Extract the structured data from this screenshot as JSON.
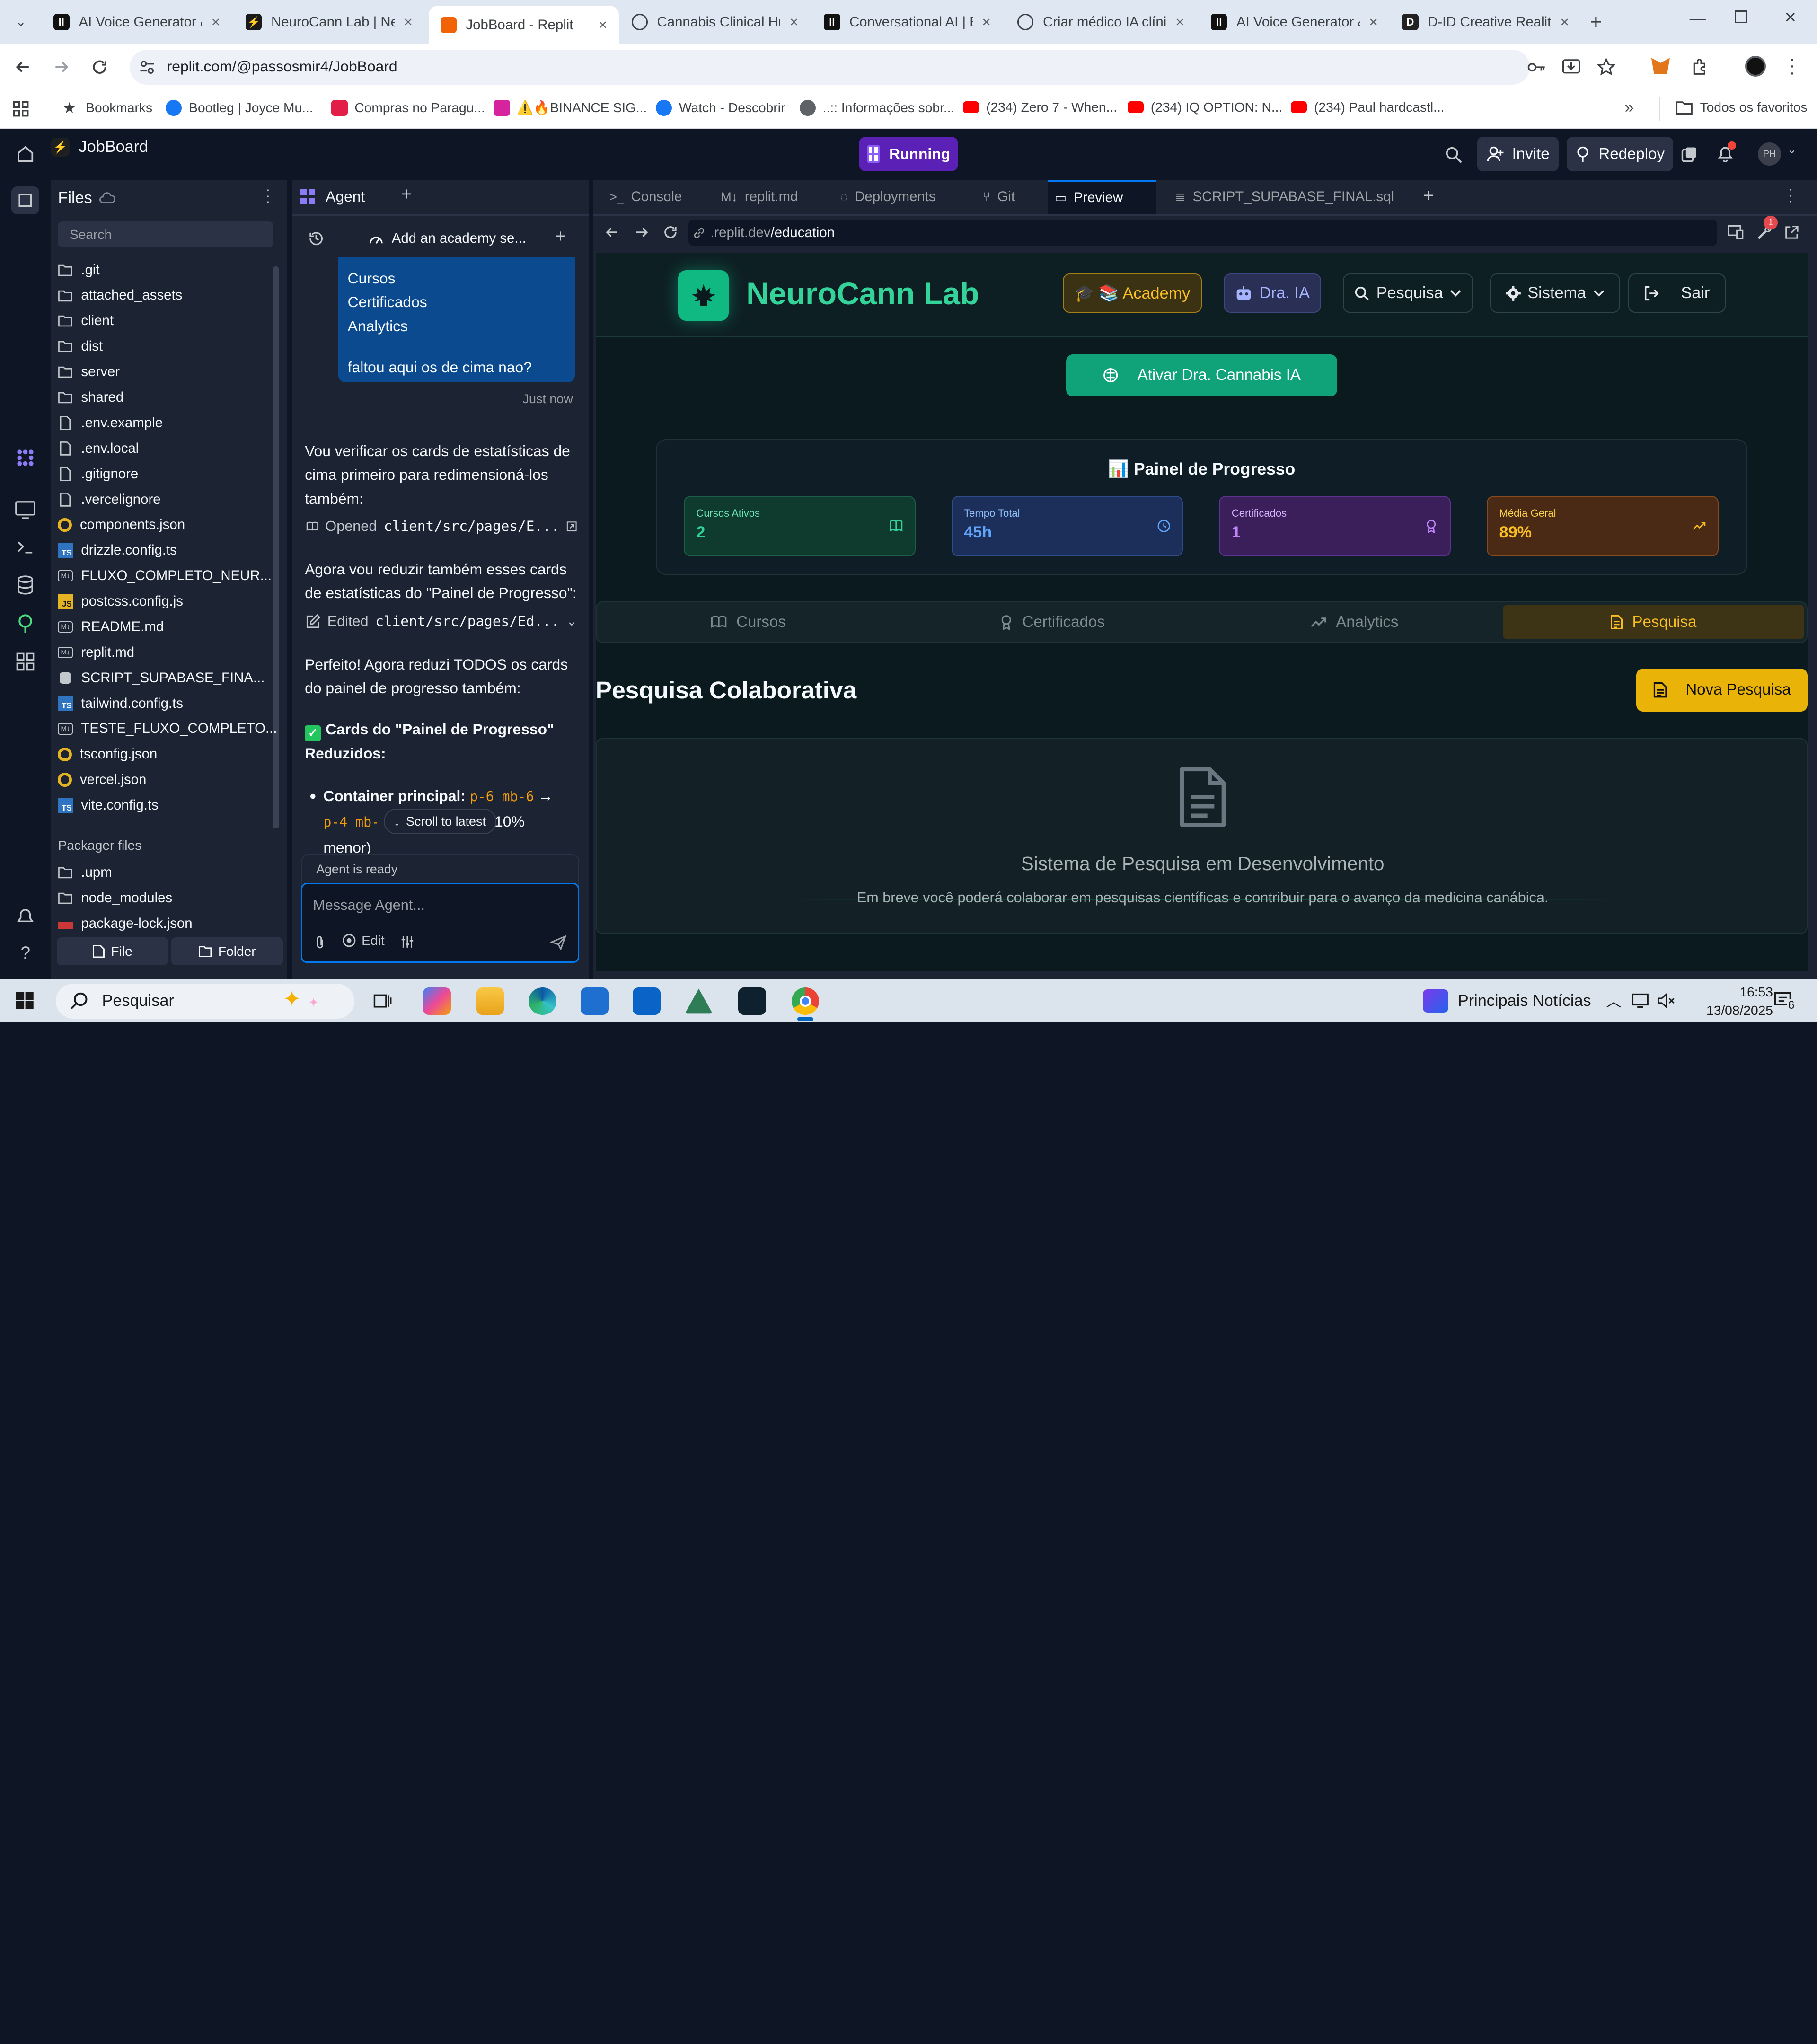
{
  "browser": {
    "tabs": [
      {
        "title": "AI Voice Generator &",
        "active": false,
        "icon": "elevenlabs-icon"
      },
      {
        "title": "NeuroCann Lab | Ne",
        "active": false,
        "icon": "bolt-icon"
      },
      {
        "title": "JobBoard - Replit",
        "active": true,
        "icon": "replit-icon"
      },
      {
        "title": "Cannabis Clinical Hu",
        "active": false,
        "icon": "globe-icon"
      },
      {
        "title": "Conversational AI | E",
        "active": false,
        "icon": "elevenlabs-icon"
      },
      {
        "title": "Criar médico IA clínic",
        "active": false,
        "icon": "openai-icon"
      },
      {
        "title": "AI Voice Generator &",
        "active": false,
        "icon": "elevenlabs-icon"
      },
      {
        "title": "D-ID Creative Reality",
        "active": false,
        "icon": "did-icon"
      }
    ],
    "url": "replit.com/@passosmir4/JobBoard",
    "bookmarks": [
      {
        "label": "Bookmarks",
        "icon": "star-icon"
      },
      {
        "label": "Bootleg | Joyce Mu...",
        "icon": "facebook-icon"
      },
      {
        "label": "Compras no Paragu...",
        "icon": "pin-icon"
      },
      {
        "label": "⚠️🔥BINANCE SIG...",
        "icon": "instagram-icon"
      },
      {
        "label": "Watch - Descobrir",
        "icon": "facebook-icon"
      },
      {
        "label": "..:: Informações sobr...",
        "icon": "globe-icon"
      },
      {
        "label": "(234) Zero 7 - When...",
        "icon": "youtube-icon"
      },
      {
        "label": "(234) IQ OPTION: N...",
        "icon": "youtube-icon"
      },
      {
        "label": "(234) Paul hardcastl...",
        "icon": "youtube-icon"
      }
    ],
    "all_favorites": "Todos os favoritos"
  },
  "replit": {
    "project": "JobBoard",
    "status": "Running",
    "invite": "Invite",
    "redeploy": "Redeploy",
    "avatar": "PH",
    "files": {
      "title": "Files",
      "search_placeholder": "Search",
      "items": [
        {
          "name": ".git",
          "type": "folder"
        },
        {
          "name": "attached_assets",
          "type": "folder"
        },
        {
          "name": "client",
          "type": "folder"
        },
        {
          "name": "dist",
          "type": "folder"
        },
        {
          "name": "server",
          "type": "folder"
        },
        {
          "name": "shared",
          "type": "folder"
        },
        {
          "name": ".env.example",
          "type": "file"
        },
        {
          "name": ".env.local",
          "type": "file"
        },
        {
          "name": ".gitignore",
          "type": "file"
        },
        {
          "name": ".vercelignore",
          "type": "file"
        },
        {
          "name": "components.json",
          "type": "json"
        },
        {
          "name": "drizzle.config.ts",
          "type": "ts"
        },
        {
          "name": "FLUXO_COMPLETO_NEUR...",
          "type": "md"
        },
        {
          "name": "postcss.config.js",
          "type": "js"
        },
        {
          "name": "README.md",
          "type": "md"
        },
        {
          "name": "replit.md",
          "type": "md"
        },
        {
          "name": "SCRIPT_SUPABASE_FINA...",
          "type": "db"
        },
        {
          "name": "tailwind.config.ts",
          "type": "ts"
        },
        {
          "name": "TESTE_FLUXO_COMPLETO...",
          "type": "md"
        },
        {
          "name": "tsconfig.json",
          "type": "json"
        },
        {
          "name": "vercel.json",
          "type": "json"
        },
        {
          "name": "vite.config.ts",
          "type": "ts"
        }
      ],
      "packager_title": "Packager files",
      "packager_items": [
        {
          "name": ".upm",
          "type": "folder"
        },
        {
          "name": "node_modules",
          "type": "folder"
        },
        {
          "name": "package-lock.json",
          "type": "npm"
        }
      ],
      "new_file": "File",
      "new_folder": "Folder"
    },
    "agent": {
      "title": "Agent",
      "thread": "Add an academy se...",
      "user_lines": [
        "Cursos",
        "Certificados",
        "Analytics"
      ],
      "user_question": "faltou aqui os de cima nao?",
      "timestamp": "Just now",
      "msg1": "Vou verificar os cards de estatísticas de cima primeiro para redimensioná-los também:",
      "opened_label": "Opened",
      "opened_path": "client/src/pages/E...",
      "msg2": "Agora vou reduzir também esses cards de estatísticas do \"Painel de Progresso\":",
      "edited_label": "Edited",
      "edited_path": "client/src/pages/Ed...",
      "msg3": "Perfeito! Agora reduzi TODOS os cards do painel de progresso também:",
      "heading": "Cards do \"Painel de Progresso\" Reduzidos",
      "bullet_label": "Container principal:",
      "code_from": "p-6 mb-6",
      "arrow": "→",
      "code_to": "p-4 mb-",
      "bullet_tail": "10%",
      "bullet_tail2": "menor)",
      "scroll_latest": "Scroll to latest",
      "ready": "Agent is ready",
      "input_placeholder": "Message Agent...",
      "edit_label": "Edit"
    },
    "right_tabs": [
      {
        "label": "Console",
        "active": false
      },
      {
        "label": "replit.md",
        "active": false
      },
      {
        "label": "Deployments",
        "active": false
      },
      {
        "label": "Git",
        "active": false
      },
      {
        "label": "Preview",
        "active": true
      },
      {
        "label": "SCRIPT_SUPABASE_FINAL.sql",
        "active": false
      }
    ],
    "preview_url_prefix": ".replit.dev",
    "preview_url_path": "/education",
    "notification_count": "1"
  },
  "app": {
    "brand": "NeuroCann Lab",
    "nav": {
      "academy": "🎓 📚 Academy",
      "dra_ia": "Dra. IA",
      "pesquisa": "Pesquisa",
      "sistema": "Sistema",
      "sair": "Sair"
    },
    "activate_button": "Ativar Dra. Cannabis IA",
    "progress_title": "📊 Painel de Progresso",
    "stats": [
      {
        "label": "Cursos Ativos",
        "value": "2",
        "icon": "book-icon",
        "color": "#10b981"
      },
      {
        "label": "Tempo Total",
        "value": "45h",
        "icon": "clock-icon",
        "color": "#60a5fa"
      },
      {
        "label": "Certificados",
        "value": "1",
        "icon": "award-icon",
        "color": "#c084fc"
      },
      {
        "label": "Média Geral",
        "value": "89%",
        "icon": "trending-up-icon",
        "color": "#fbbf24"
      }
    ],
    "tabs": [
      {
        "label": "Cursos",
        "active": false
      },
      {
        "label": "Certificados",
        "active": false
      },
      {
        "label": "Analytics",
        "active": false
      },
      {
        "label": "Pesquisa",
        "active": true
      }
    ],
    "section_title": "Pesquisa Colaborativa",
    "new_research": "Nova Pesquisa",
    "empty_title": "Sistema de Pesquisa em Desenvolvimento",
    "empty_text": "Em breve você poderá colaborar em pesquisas científicas e contribuir para o avanço da medicina canábica."
  },
  "taskbar": {
    "search": "Pesquisar",
    "news": "Principais Notícias",
    "time": "16:53",
    "date": "13/08/2025",
    "notif": "6"
  }
}
